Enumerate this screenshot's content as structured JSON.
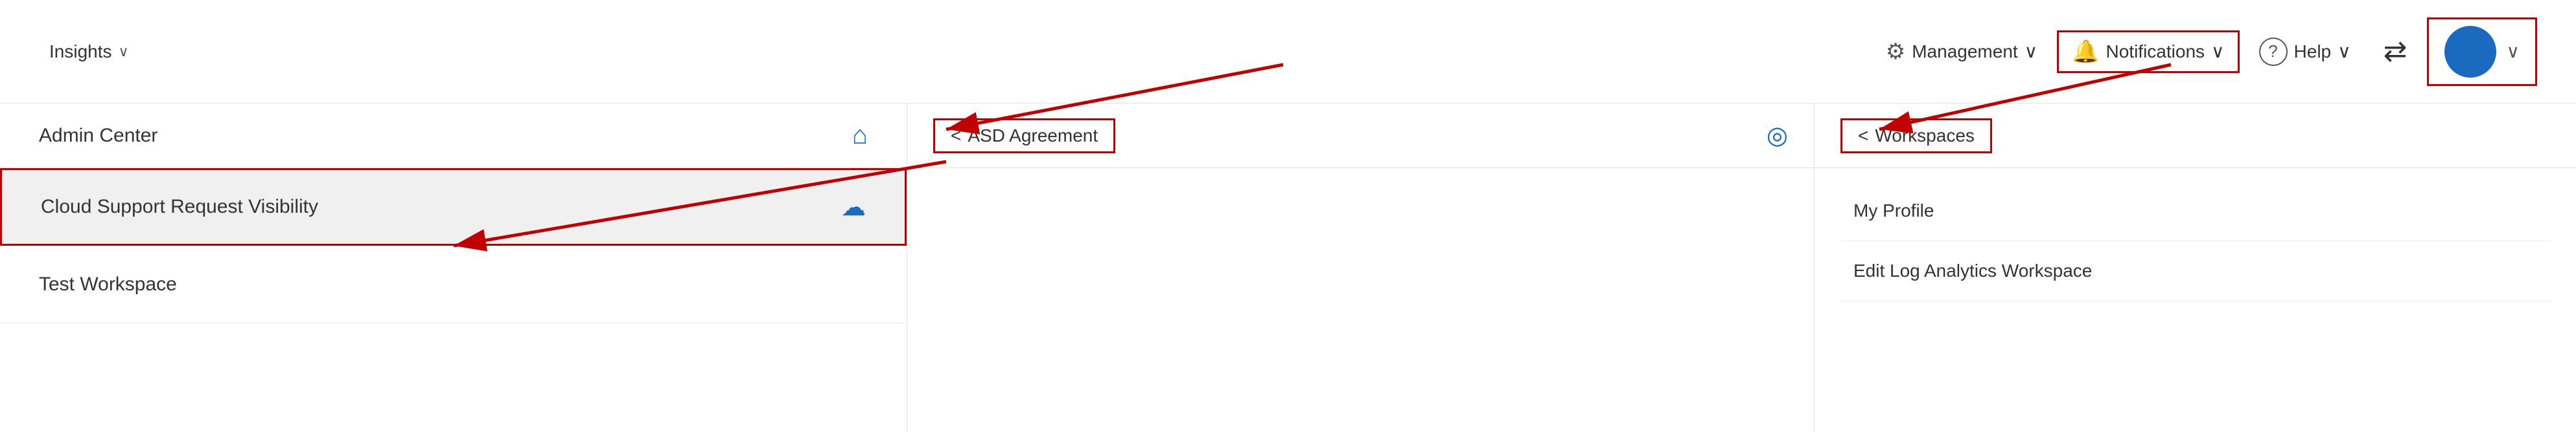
{
  "topNav": {
    "insights_label": "Insights",
    "management_label": "Management",
    "notifications_label": "Notifications",
    "help_label": "Help",
    "chevron": "∨"
  },
  "leftPanel": {
    "header": "Admin Center",
    "items": [
      {
        "label": "Cloud Support Request Visibility",
        "icon": "cloud",
        "highlighted": true
      },
      {
        "label": "Test Workspace",
        "icon": "",
        "highlighted": false
      }
    ]
  },
  "middlePanel": {
    "back_label": "ASD Agreement",
    "icon": "eye"
  },
  "rightPanel": {
    "back_label": "Workspaces",
    "items": [
      {
        "label": "My Profile"
      },
      {
        "label": "Edit Log Analytics Workspace"
      }
    ]
  },
  "icons": {
    "gear": "⚙",
    "bell": "🔔",
    "question": "?",
    "user": "👤",
    "home": "🏠",
    "cloud": "☁",
    "eye": "👁",
    "chevron_left": "<",
    "chevron_down": "∨"
  }
}
